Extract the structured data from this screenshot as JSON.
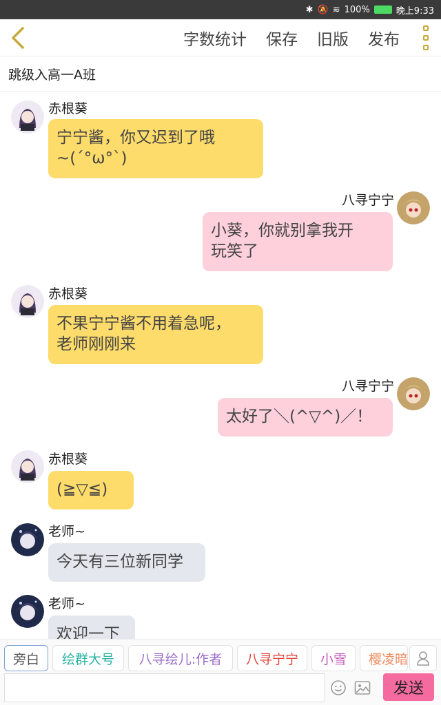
{
  "status_bar": {
    "battery": "100%",
    "time": "晚上9:33"
  },
  "toolbar": {
    "actions": [
      "字数统计",
      "保存",
      "旧版",
      "发布"
    ]
  },
  "chat": {
    "title": "跳级入高一A班"
  },
  "messages": [
    {
      "sender": "赤根葵",
      "text": "宁宁酱，你又迟到了哦\n~(´°ω°`)"
    },
    {
      "sender": "八寻宁宁",
      "text": "小葵，你就别拿我开\n玩笑了"
    },
    {
      "sender": "赤根葵",
      "text": "不果宁宁酱不用着急呢，\n老师刚刚来"
    },
    {
      "sender": "八寻宁宁",
      "text": "太好了＼(^▽^)／！"
    },
    {
      "sender": "赤根葵",
      "text": "(≧▽≦)"
    },
    {
      "sender": "老师~",
      "text": "今天有三位新同学"
    },
    {
      "sender": "老师~",
      "text": "欢迎一下"
    }
  ],
  "characters": [
    {
      "label": "旁白",
      "color": "#555555"
    },
    {
      "label": "绘群大号",
      "color": "#2bb3a3"
    },
    {
      "label": "八寻绘儿:作者",
      "color": "#9a6bc7"
    },
    {
      "label": "八寻宁宁",
      "color": "#e0453a"
    },
    {
      "label": "小雪",
      "color": "#c45ab8"
    },
    {
      "label": "樱凌暗",
      "color": "#f08a5d"
    }
  ],
  "composer": {
    "placeholder": "",
    "send_label": "发送"
  }
}
